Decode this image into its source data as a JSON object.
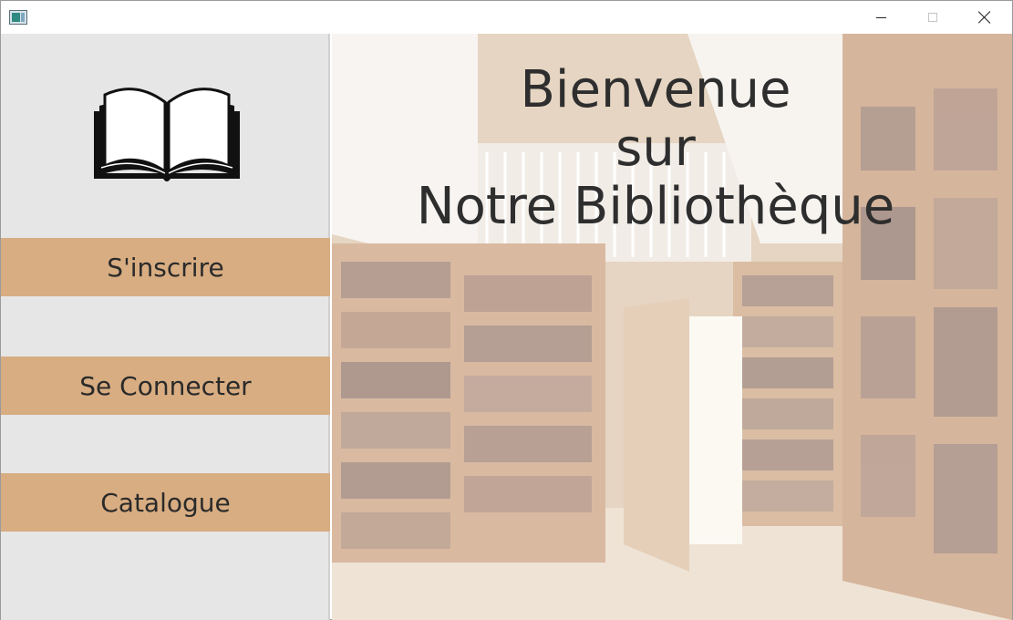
{
  "window": {
    "title": "",
    "controls": {
      "minimize": "minimize",
      "maximize": "maximize",
      "close": "close"
    }
  },
  "sidebar": {
    "logo_icon": "open-book-icon",
    "buttons": [
      {
        "label": "S'inscrire"
      },
      {
        "label": "Se Connecter"
      },
      {
        "label": "Catalogue"
      }
    ]
  },
  "hero": {
    "background": "library-bookshelves-image",
    "welcome_lines": [
      "Bienvenue",
      "sur",
      "Notre Bibliothèque"
    ]
  },
  "colors": {
    "sidebar_bg": "#e6e6e6",
    "button_bg": "#d8ad82",
    "text": "#2e2e2e"
  }
}
